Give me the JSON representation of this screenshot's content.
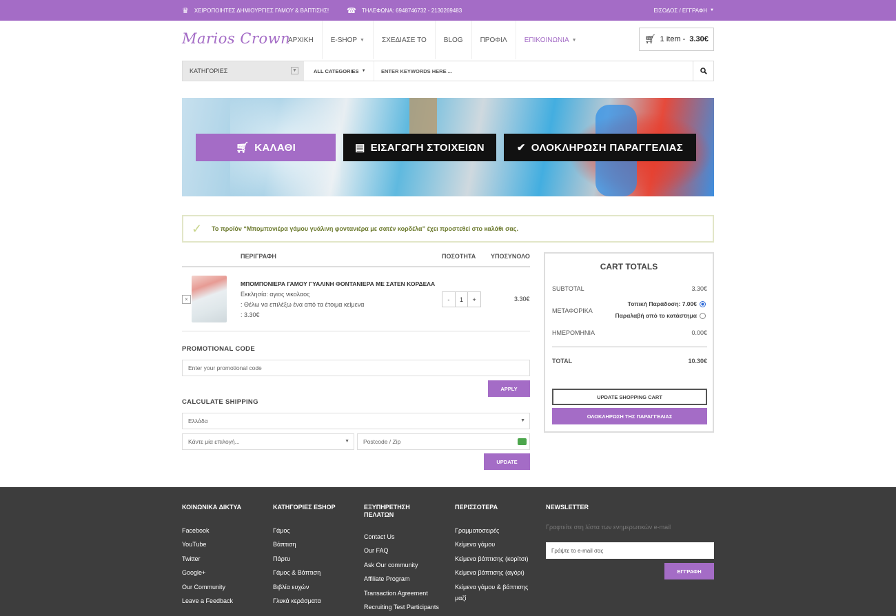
{
  "topbar": {
    "tagline": "ΧΕΙΡΟΠΟΙΗΤΕΣ ΔΗΜΙΟΥΡΓΙΕΣ ΓΑΜΟΥ & ΒΑΠΤΙΣΗΣ!",
    "phone": "ΤΗΛΕΦΩΝΑ: 6948746732 - 2130269483",
    "login": "ΕΙΣΟΔΟΣ / ΕΓΓΡΑΦΗ"
  },
  "header": {
    "logo": "Marios Crown",
    "nav": [
      "ΑΡΧΙΚΗ",
      "E-SHOP",
      "ΣΧΕΔΙΑΣΕ ΤΟ",
      "BLOG",
      "ΠΡΟΦΙΛ",
      "ΕΠΙΚΟΙΝΩΝΙΑ"
    ],
    "cart_items": "1 item -",
    "cart_total": "3.30€"
  },
  "search": {
    "categories_label": "ΚΑΤΗΓΟΡΙΕΣ",
    "all_categories": "ALL CATEGORIES",
    "placeholder": "ENTER KEYWORDS HERE ..."
  },
  "steps": [
    "ΚΑΛΑΘΙ",
    "ΕΙΣΑΓΩΓΗ ΣΤΟΙΧΕΙΩΝ",
    "ΟΛΟΚΛΗΡΩΣΗ ΠΑΡΑΓΓΕΛΙΑΣ"
  ],
  "notice": "Το προϊόν “Μπομπονιέρα γάμου γυάλινη φοντανιέρα με σατέν κορδέλα” έχει προστεθεί στο καλάθι σας.",
  "cart": {
    "headers": {
      "description": "ΠΕΡΙΓΡΑΦΗ",
      "quantity": "ΠΟΣΟΤΗΤΑ",
      "subtotal": "ΥΠΟΣΥΝΟΛΟ"
    },
    "item": {
      "name": "ΜΠΟΜΠΟΝΙΕΡΑ ΓΑΜΟΥ ΓΥΑΛΙΝΗ ΦΟΝΤΑΝΙΕΡΑ ΜΕ ΣΑΤΕΝ ΚΟΡΔΕΛΑ",
      "church": "Εκκλησία: αγιος νικολαος",
      "text_option": ": Θέλω να επιλέξω ένα από τα έτοιμα κείμενα",
      "price_line": ":   3.30€",
      "qty": "1",
      "minus": "-",
      "plus": "+",
      "remove": "×",
      "total": "3.30€"
    }
  },
  "promo": {
    "title": "PROMOTIONAL CODE",
    "placeholder": "Enter your promotional code",
    "apply": "APPLY"
  },
  "shipping": {
    "title": "CALCULATE SHIPPING",
    "country": "Ελλάδα",
    "region": "Κάντε μία επιλογή...",
    "postcode": "Postcode / Zip",
    "update": "UPDATE"
  },
  "totals": {
    "title": "CART TOTALS",
    "subtotal_label": "SUBTOTAL",
    "subtotal": "3.30€",
    "shipping_label": "ΜΕΤΑΦΟΡΙΚΑ",
    "ship_opt1": "Τοπική Παράδοση: 7.00€",
    "ship_opt2": "Παραλαβή από το κατάστημα",
    "date_label": "ΗΜΕΡΟΜΗΝΙΑ",
    "date_value": "0.00€",
    "total_label": "TOTAL",
    "total": "10.30€",
    "update_cart": "UPDATE SHOPPING CART",
    "checkout": "ΟΛΟΚΛΗΡΩΣΗ ΤΗΣ ΠΑΡΑΓΓΕΛΙΑΣ"
  },
  "footer": {
    "social": {
      "title": "ΚΟΙΝΩΝΙΚΑ ΔΙΚΤΥΑ",
      "items": [
        "Facebook",
        "YouTube",
        "Twitter",
        "Google+",
        "Our Community",
        "Leave a Feedback"
      ]
    },
    "categories": {
      "title": "ΚΑΤΗΓΟΡΙΕΣ ESHOP",
      "items": [
        "Γάμος",
        "Βάπτιση",
        "Πάρτυ",
        "Γάμος & Βάπτιση",
        "Βιβλία ευχών",
        "Γλυκά κεράσματα"
      ]
    },
    "service": {
      "title_line1": "ΕΞΥΠΗΡΕΤΗΣΗ",
      "title_line2": "ΠΕΛΑΤΩΝ",
      "items": [
        "Contact Us",
        "Our FAQ",
        "Ask Our community",
        "Affiliate Program",
        "Transaction Agreement",
        "Recruiting Test Participants"
      ]
    },
    "more": {
      "title": "ΠΕΡΙΣΣΟΤΕΡΑ",
      "items": [
        "Γραμματοσειρές",
        "Κείμενα γάμου",
        "Κείμενα βάπτισης (κορίτσι)",
        "Κείμενα βάπτισης (αγόρι)",
        "Κείμενα γάμου & βάπτισης",
        "μαζί"
      ]
    },
    "newsletter": {
      "title": "NEWSLETTER",
      "text": "Γραφτείτε στη λίστα των ενημερωτικών e-mail",
      "placeholder": "Γράψτε το e-mail σας",
      "button": "ΕΓΓΡΑΦΗ"
    }
  }
}
